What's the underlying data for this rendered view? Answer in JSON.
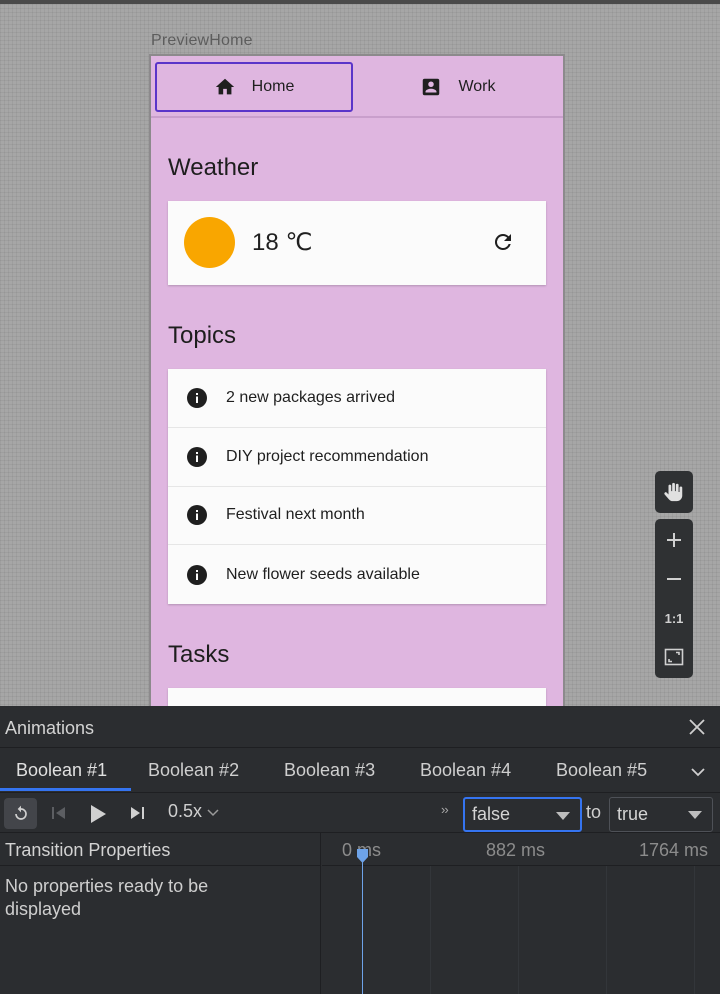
{
  "preview": {
    "label": "PreviewHome",
    "tabs": [
      {
        "label": "Home",
        "icon": "home-icon",
        "selected": true
      },
      {
        "label": "Work",
        "icon": "work-icon",
        "selected": false
      }
    ],
    "weather": {
      "title": "Weather",
      "temperature": "18 ℃",
      "sun_color": "#f9a600"
    },
    "topics": {
      "title": "Topics",
      "items": [
        "2 new packages arrived",
        "DIY project recommendation",
        "Festival next month",
        "New flower seeds available"
      ]
    },
    "tasks": {
      "title": "Tasks"
    }
  },
  "canvas_tools": {
    "buttons": [
      "pan-hand",
      "zoom-in",
      "zoom-out",
      "1:1",
      "zoom-to-fit"
    ],
    "one_to_one_label": "1:1"
  },
  "animations_panel": {
    "title": "Animations",
    "tabs": [
      "Boolean #1",
      "Boolean #2",
      "Boolean #3",
      "Boolean #4",
      "Boolean #5"
    ],
    "active_tab": 0,
    "speed": "0.5x",
    "from_value": "false",
    "to_label": "to",
    "to_value": "true",
    "transition_properties": {
      "title": "Transition Properties",
      "empty_message": "No properties ready to be displayed"
    },
    "timeline": {
      "ticks": [
        "0 ms",
        "882 ms",
        "1764 ms"
      ]
    }
  },
  "colors": {
    "device_background": "#dfb6e0",
    "selected_tab_border": "#5a35c9",
    "panel_background": "#2b2d30",
    "accent_blue": "#3574f0"
  }
}
